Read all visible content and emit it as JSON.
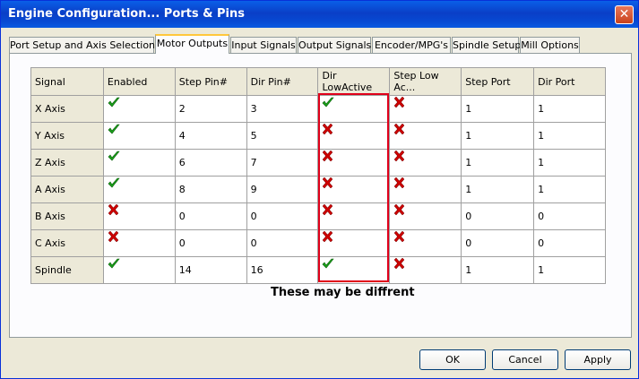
{
  "window": {
    "title": "Engine Configuration... Ports & Pins"
  },
  "tabs": [
    {
      "label": "Port Setup and Axis Selection"
    },
    {
      "label": "Motor Outputs"
    },
    {
      "label": "Input Signals"
    },
    {
      "label": "Output Signals"
    },
    {
      "label": "Encoder/MPG's"
    },
    {
      "label": "Spindle Setup"
    },
    {
      "label": "Mill Options"
    }
  ],
  "active_tab": "Motor Outputs",
  "table": {
    "headers": [
      "Signal",
      "Enabled",
      "Step Pin#",
      "Dir Pin#",
      "Dir LowActive",
      "Step Low Ac...",
      "Step Port",
      "Dir Port"
    ],
    "rows": [
      {
        "signal": "X Axis",
        "enabled": "check",
        "step_pin": "2",
        "dir_pin": "3",
        "dir_low": "check",
        "step_low": "cross",
        "step_port": "1",
        "dir_port": "1"
      },
      {
        "signal": "Y Axis",
        "enabled": "check",
        "step_pin": "4",
        "dir_pin": "5",
        "dir_low": "cross",
        "step_low": "cross",
        "step_port": "1",
        "dir_port": "1"
      },
      {
        "signal": "Z Axis",
        "enabled": "check",
        "step_pin": "6",
        "dir_pin": "7",
        "dir_low": "cross",
        "step_low": "cross",
        "step_port": "1",
        "dir_port": "1"
      },
      {
        "signal": "A Axis",
        "enabled": "check",
        "step_pin": "8",
        "dir_pin": "9",
        "dir_low": "cross",
        "step_low": "cross",
        "step_port": "1",
        "dir_port": "1"
      },
      {
        "signal": "B Axis",
        "enabled": "cross",
        "step_pin": "0",
        "dir_pin": "0",
        "dir_low": "cross",
        "step_low": "cross",
        "step_port": "0",
        "dir_port": "0"
      },
      {
        "signal": "C Axis",
        "enabled": "cross",
        "step_pin": "0",
        "dir_pin": "0",
        "dir_low": "cross",
        "step_low": "cross",
        "step_port": "0",
        "dir_port": "0"
      },
      {
        "signal": "Spindle",
        "enabled": "check",
        "step_pin": "14",
        "dir_pin": "16",
        "dir_low": "check",
        "step_low": "cross",
        "step_port": "1",
        "dir_port": "1"
      }
    ]
  },
  "annotation": "These may be diffrent",
  "buttons": {
    "ok": "OK",
    "cancel": "Cancel",
    "apply": "Apply"
  },
  "colors": {
    "check": "#1aa31a",
    "cross": "#cc0000",
    "highlight": "#e0001a",
    "title_bar": "#0a4fd8"
  }
}
